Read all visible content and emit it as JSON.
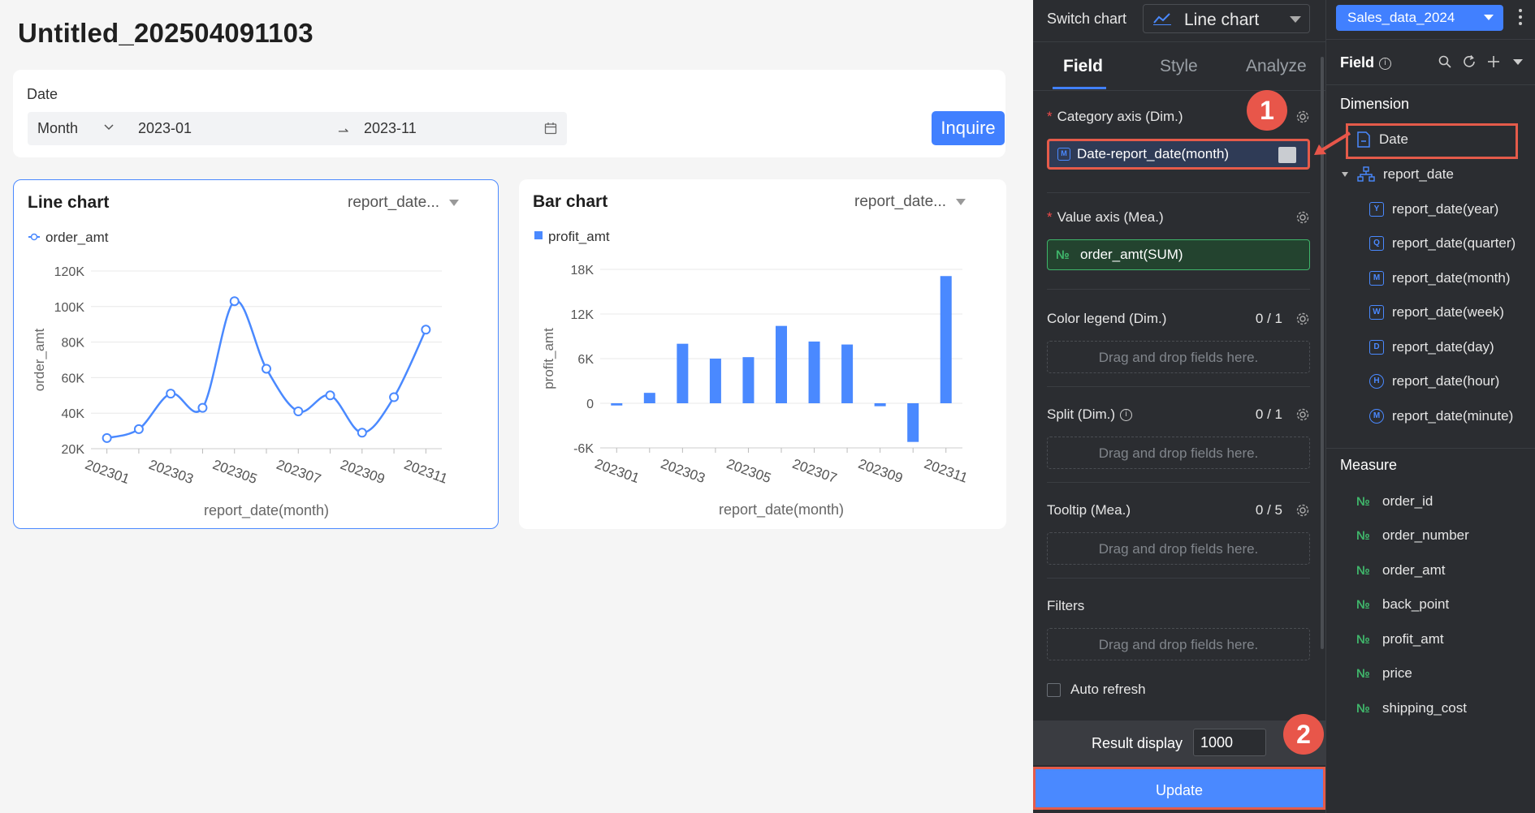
{
  "page": {
    "title": "Untitled_202504091103"
  },
  "filter": {
    "label": "Date",
    "granularity": "Month",
    "start": "2023-01",
    "end": "2023-11",
    "inquire_label": "Inquire"
  },
  "line_chart": {
    "title": "Line chart",
    "selector": "report_date...",
    "legend": "order_amt",
    "ylabel": "order_amt",
    "xlabel": "report_date(month)",
    "color": "#4a89ff"
  },
  "bar_chart": {
    "title": "Bar chart",
    "selector": "report_date...",
    "legend": "profit_amt",
    "ylabel": "profit_amt",
    "xlabel": "report_date(month)",
    "color": "#4a89ff"
  },
  "chart_data": [
    {
      "type": "line",
      "title": "Line chart",
      "xlabel": "report_date(month)",
      "ylabel": "order_amt",
      "x": [
        "202301",
        "202302",
        "202303",
        "202304",
        "202305",
        "202306",
        "202307",
        "202308",
        "202309",
        "202310",
        "202311"
      ],
      "x_tick_labels": [
        "202301",
        "202303",
        "202305",
        "202307",
        "202309",
        "202311"
      ],
      "y_tick_labels": [
        "20K",
        "40K",
        "60K",
        "80K",
        "100K",
        "120K"
      ],
      "series": [
        {
          "name": "order_amt",
          "values": [
            26000,
            31000,
            51000,
            43000,
            103000,
            65000,
            41000,
            50000,
            29000,
            49000,
            87000
          ]
        }
      ],
      "ylim": [
        20000,
        120000
      ],
      "grid": true,
      "legend": "top-left"
    },
    {
      "type": "bar",
      "title": "Bar chart",
      "xlabel": "report_date(month)",
      "ylabel": "profit_amt",
      "x": [
        "202301",
        "202302",
        "202303",
        "202304",
        "202305",
        "202306",
        "202307",
        "202308",
        "202309",
        "202310",
        "202311"
      ],
      "x_tick_labels": [
        "202301",
        "202303",
        "202305",
        "202307",
        "202309",
        "202311"
      ],
      "y_tick_labels": [
        "-6K",
        "0",
        "6K",
        "12K",
        "18K"
      ],
      "series": [
        {
          "name": "profit_amt",
          "values": [
            -300,
            1400,
            8000,
            6000,
            6200,
            10400,
            8300,
            7900,
            -400,
            -5200,
            17100
          ]
        }
      ],
      "ylim": [
        -6000,
        18000
      ],
      "grid": true,
      "legend": "top-left"
    }
  ],
  "config": {
    "switch_label": "Switch chart",
    "chart_type": "Line chart",
    "tabs": [
      "Field",
      "Style",
      "Analyze"
    ],
    "active_tab": "Field",
    "category_axis": {
      "label": "Category axis (Dim.)",
      "field": "Date-report_date(month)"
    },
    "value_axis": {
      "label": "Value axis (Mea.)",
      "field": "order_amt(SUM)"
    },
    "color_legend": {
      "label": "Color legend (Dim.)",
      "count": "0 / 1",
      "placeholder": "Drag and drop fields here."
    },
    "split": {
      "label": "Split (Dim.)",
      "count": "0 / 1",
      "placeholder": "Drag and drop fields here."
    },
    "tooltip": {
      "label": "Tooltip (Mea.)",
      "count": "0 / 5",
      "placeholder": "Drag and drop fields here."
    },
    "filters": {
      "label": "Filters",
      "placeholder": "Drag and drop fields here."
    },
    "auto_refresh": "Auto refresh",
    "result_display_label": "Result display",
    "result_display_value": "1000",
    "update_label": "Update"
  },
  "fields": {
    "dataset": "Sales_data_2024",
    "header": "Field",
    "dimension_title": "Dimension",
    "dimension_date": "Date",
    "hierarchy": "report_date",
    "date_parts": [
      {
        "label": "report_date(year)",
        "icon": "Y"
      },
      {
        "label": "report_date(quarter)",
        "icon": "Q"
      },
      {
        "label": "report_date(month)",
        "icon": "M"
      },
      {
        "label": "report_date(week)",
        "icon": "W"
      },
      {
        "label": "report_date(day)",
        "icon": "D"
      },
      {
        "label": "report_date(hour)",
        "icon": "H"
      },
      {
        "label": "report_date(minute)",
        "icon": "M"
      }
    ],
    "measure_title": "Measure",
    "measures": [
      "order_id",
      "order_number",
      "order_amt",
      "back_point",
      "profit_amt",
      "price",
      "shipping_cost"
    ],
    "measure_icon": "№"
  },
  "annotations": {
    "step1": "1",
    "step2": "2"
  }
}
